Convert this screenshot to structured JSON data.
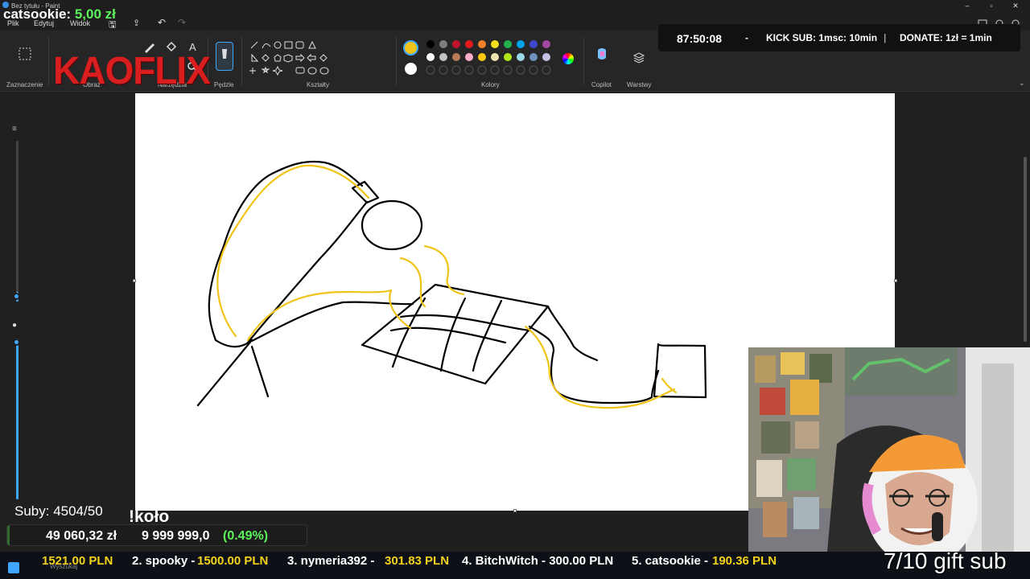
{
  "window": {
    "title": "Bez tytułu - Paint"
  },
  "menu": {
    "file": "Plik",
    "edit": "Edytuj",
    "view": "Widok"
  },
  "ribbon": {
    "groups": {
      "selection": "Zaznaczenie",
      "image": "Obraz",
      "tools": "Narzędzia",
      "brushes": "Pędzle",
      "shapes": "Kształty",
      "colors": "Kolory",
      "copilot": "Copilot",
      "layers": "Warstwy"
    },
    "palette_top": [
      "#f0c419",
      "#000000",
      "#7f7f7f",
      "#c0142c",
      "#e41b1b",
      "#f5822a",
      "#f7e01e",
      "#22b14c",
      "#00a2e8",
      "#3f48cc",
      "#a349a4"
    ],
    "palette_row2": [
      "#ffffff",
      "#c3c3c3",
      "#b97a57",
      "#ffaec9",
      "#ffc90e",
      "#efe4b0",
      "#b5e61d",
      "#99d9ea",
      "#7092be",
      "#c8bfe7"
    ],
    "secondary_color": "#ffffff"
  },
  "overlay": {
    "logo": "KAOFLIX",
    "top_donor_name": "catsookie:",
    "top_donor_amount": "5,00 zł",
    "timer": "87:50:08",
    "sep": "-",
    "kick_sub": "KICK SUB: 1msc: 10min",
    "bar": "|",
    "donate": "DONATE: 1zł = 1min",
    "subs": "Suby: 4504/50",
    "kolo": "!koło",
    "goal_current": "49 060,32 zł",
    "goal_target": "9 999 999,0",
    "goal_percent_text": "(0.49%)",
    "goal_percent": 0.49,
    "gift_sub": "7/10 gift sub",
    "ticker": [
      {
        "label": "1521.00 PLN",
        "amount": true
      },
      {
        "label": "2. spooky -",
        "amount": false
      },
      {
        "label": "1500.00 PLN",
        "amount": true
      },
      {
        "label": "3. nymeria392 -",
        "amount": false
      },
      {
        "label": "301.83 PLN",
        "amount": true
      },
      {
        "label": "4. BitchWitch - 300.00 PLN",
        "amount": false
      },
      {
        "label": "5. catsookie -",
        "amount": false
      },
      {
        "label": "190.36 PLN",
        "amount": true
      }
    ],
    "taskbar_search": "Wyszukaj"
  }
}
